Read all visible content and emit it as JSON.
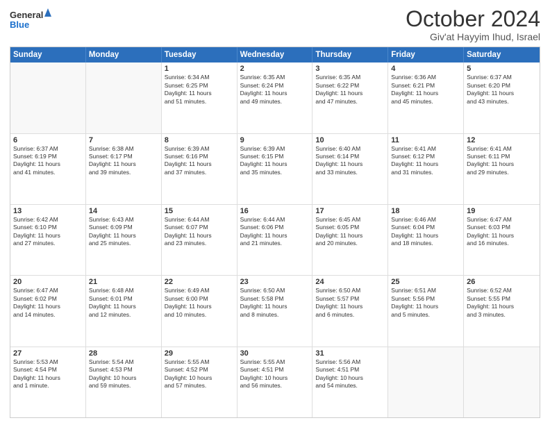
{
  "logo": {
    "line1": "General",
    "line2": "Blue"
  },
  "title": "October 2024",
  "location": "Giv'at Hayyim Ihud, Israel",
  "header_days": [
    "Sunday",
    "Monday",
    "Tuesday",
    "Wednesday",
    "Thursday",
    "Friday",
    "Saturday"
  ],
  "rows": [
    [
      {
        "day": "",
        "lines": []
      },
      {
        "day": "",
        "lines": []
      },
      {
        "day": "1",
        "lines": [
          "Sunrise: 6:34 AM",
          "Sunset: 6:25 PM",
          "Daylight: 11 hours",
          "and 51 minutes."
        ]
      },
      {
        "day": "2",
        "lines": [
          "Sunrise: 6:35 AM",
          "Sunset: 6:24 PM",
          "Daylight: 11 hours",
          "and 49 minutes."
        ]
      },
      {
        "day": "3",
        "lines": [
          "Sunrise: 6:35 AM",
          "Sunset: 6:22 PM",
          "Daylight: 11 hours",
          "and 47 minutes."
        ]
      },
      {
        "day": "4",
        "lines": [
          "Sunrise: 6:36 AM",
          "Sunset: 6:21 PM",
          "Daylight: 11 hours",
          "and 45 minutes."
        ]
      },
      {
        "day": "5",
        "lines": [
          "Sunrise: 6:37 AM",
          "Sunset: 6:20 PM",
          "Daylight: 11 hours",
          "and 43 minutes."
        ]
      }
    ],
    [
      {
        "day": "6",
        "lines": [
          "Sunrise: 6:37 AM",
          "Sunset: 6:19 PM",
          "Daylight: 11 hours",
          "and 41 minutes."
        ]
      },
      {
        "day": "7",
        "lines": [
          "Sunrise: 6:38 AM",
          "Sunset: 6:17 PM",
          "Daylight: 11 hours",
          "and 39 minutes."
        ]
      },
      {
        "day": "8",
        "lines": [
          "Sunrise: 6:39 AM",
          "Sunset: 6:16 PM",
          "Daylight: 11 hours",
          "and 37 minutes."
        ]
      },
      {
        "day": "9",
        "lines": [
          "Sunrise: 6:39 AM",
          "Sunset: 6:15 PM",
          "Daylight: 11 hours",
          "and 35 minutes."
        ]
      },
      {
        "day": "10",
        "lines": [
          "Sunrise: 6:40 AM",
          "Sunset: 6:14 PM",
          "Daylight: 11 hours",
          "and 33 minutes."
        ]
      },
      {
        "day": "11",
        "lines": [
          "Sunrise: 6:41 AM",
          "Sunset: 6:12 PM",
          "Daylight: 11 hours",
          "and 31 minutes."
        ]
      },
      {
        "day": "12",
        "lines": [
          "Sunrise: 6:41 AM",
          "Sunset: 6:11 PM",
          "Daylight: 11 hours",
          "and 29 minutes."
        ]
      }
    ],
    [
      {
        "day": "13",
        "lines": [
          "Sunrise: 6:42 AM",
          "Sunset: 6:10 PM",
          "Daylight: 11 hours",
          "and 27 minutes."
        ]
      },
      {
        "day": "14",
        "lines": [
          "Sunrise: 6:43 AM",
          "Sunset: 6:09 PM",
          "Daylight: 11 hours",
          "and 25 minutes."
        ]
      },
      {
        "day": "15",
        "lines": [
          "Sunrise: 6:44 AM",
          "Sunset: 6:07 PM",
          "Daylight: 11 hours",
          "and 23 minutes."
        ]
      },
      {
        "day": "16",
        "lines": [
          "Sunrise: 6:44 AM",
          "Sunset: 6:06 PM",
          "Daylight: 11 hours",
          "and 21 minutes."
        ]
      },
      {
        "day": "17",
        "lines": [
          "Sunrise: 6:45 AM",
          "Sunset: 6:05 PM",
          "Daylight: 11 hours",
          "and 20 minutes."
        ]
      },
      {
        "day": "18",
        "lines": [
          "Sunrise: 6:46 AM",
          "Sunset: 6:04 PM",
          "Daylight: 11 hours",
          "and 18 minutes."
        ]
      },
      {
        "day": "19",
        "lines": [
          "Sunrise: 6:47 AM",
          "Sunset: 6:03 PM",
          "Daylight: 11 hours",
          "and 16 minutes."
        ]
      }
    ],
    [
      {
        "day": "20",
        "lines": [
          "Sunrise: 6:47 AM",
          "Sunset: 6:02 PM",
          "Daylight: 11 hours",
          "and 14 minutes."
        ]
      },
      {
        "day": "21",
        "lines": [
          "Sunrise: 6:48 AM",
          "Sunset: 6:01 PM",
          "Daylight: 11 hours",
          "and 12 minutes."
        ]
      },
      {
        "day": "22",
        "lines": [
          "Sunrise: 6:49 AM",
          "Sunset: 6:00 PM",
          "Daylight: 11 hours",
          "and 10 minutes."
        ]
      },
      {
        "day": "23",
        "lines": [
          "Sunrise: 6:50 AM",
          "Sunset: 5:58 PM",
          "Daylight: 11 hours",
          "and 8 minutes."
        ]
      },
      {
        "day": "24",
        "lines": [
          "Sunrise: 6:50 AM",
          "Sunset: 5:57 PM",
          "Daylight: 11 hours",
          "and 6 minutes."
        ]
      },
      {
        "day": "25",
        "lines": [
          "Sunrise: 6:51 AM",
          "Sunset: 5:56 PM",
          "Daylight: 11 hours",
          "and 5 minutes."
        ]
      },
      {
        "day": "26",
        "lines": [
          "Sunrise: 6:52 AM",
          "Sunset: 5:55 PM",
          "Daylight: 11 hours",
          "and 3 minutes."
        ]
      }
    ],
    [
      {
        "day": "27",
        "lines": [
          "Sunrise: 5:53 AM",
          "Sunset: 4:54 PM",
          "Daylight: 11 hours",
          "and 1 minute."
        ]
      },
      {
        "day": "28",
        "lines": [
          "Sunrise: 5:54 AM",
          "Sunset: 4:53 PM",
          "Daylight: 10 hours",
          "and 59 minutes."
        ]
      },
      {
        "day": "29",
        "lines": [
          "Sunrise: 5:55 AM",
          "Sunset: 4:52 PM",
          "Daylight: 10 hours",
          "and 57 minutes."
        ]
      },
      {
        "day": "30",
        "lines": [
          "Sunrise: 5:55 AM",
          "Sunset: 4:51 PM",
          "Daylight: 10 hours",
          "and 56 minutes."
        ]
      },
      {
        "day": "31",
        "lines": [
          "Sunrise: 5:56 AM",
          "Sunset: 4:51 PM",
          "Daylight: 10 hours",
          "and 54 minutes."
        ]
      },
      {
        "day": "",
        "lines": []
      },
      {
        "day": "",
        "lines": []
      }
    ]
  ]
}
